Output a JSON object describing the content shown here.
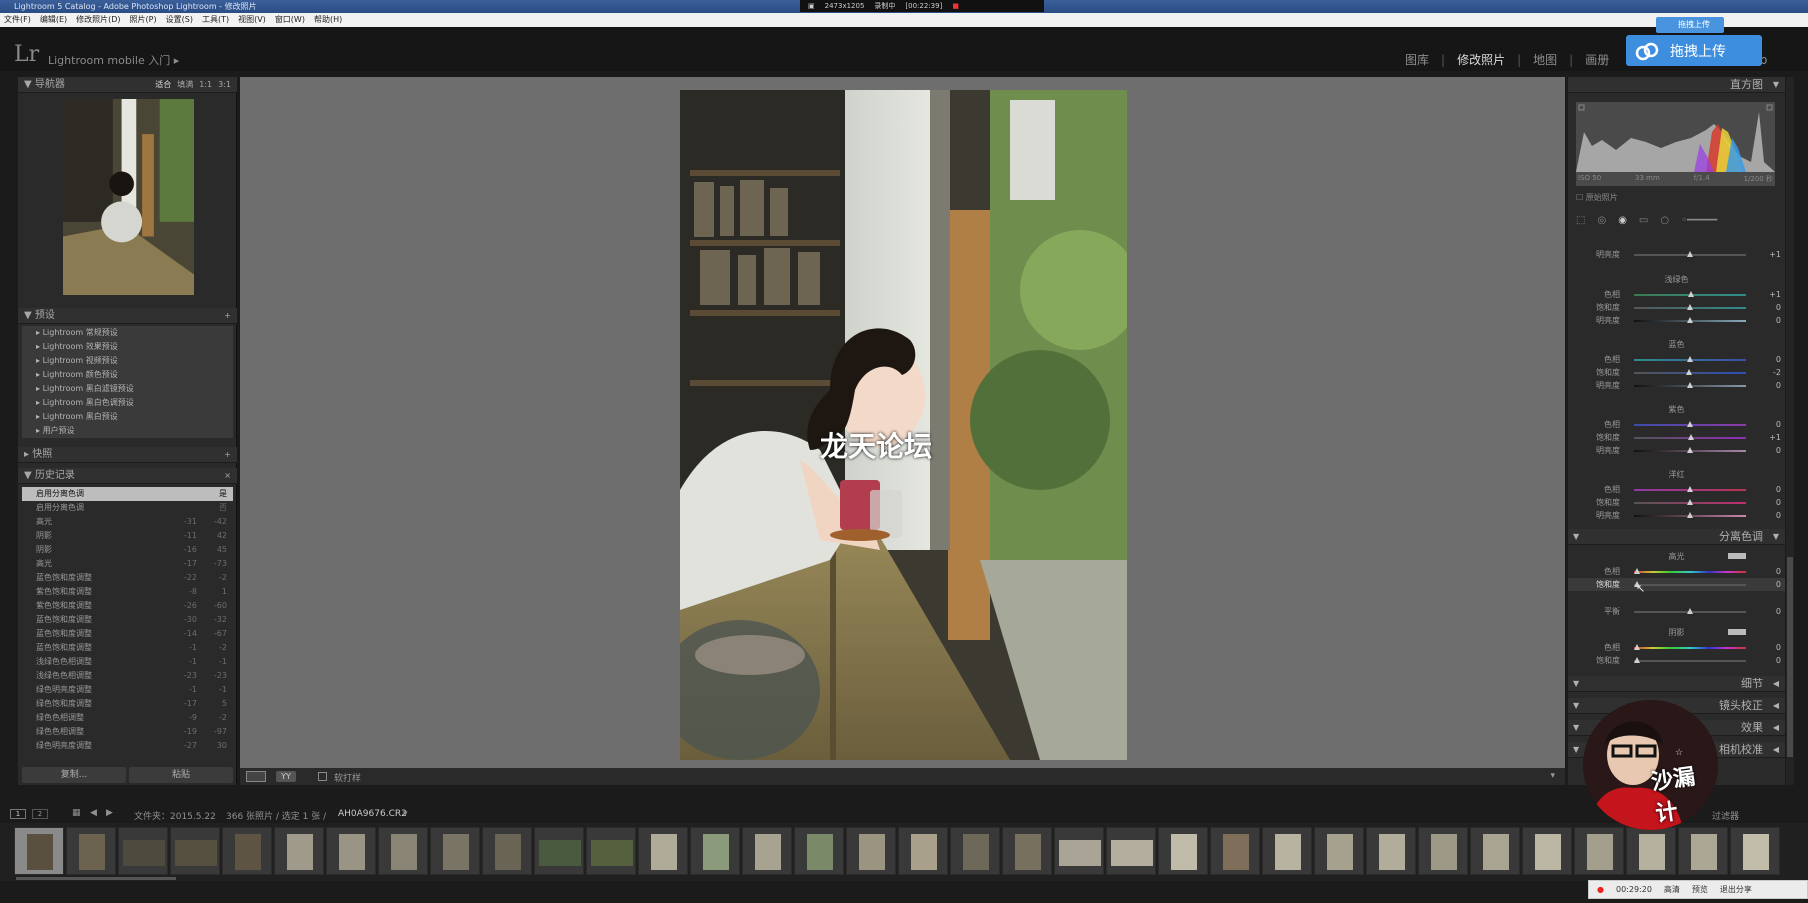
{
  "window": {
    "title": "Lightroom 5 Catalog - Adobe Photoshop Lightroom - 修改照片",
    "menu": [
      "文件(F)",
      "编辑(E)",
      "修改照片(D)",
      "照片(P)",
      "设置(S)",
      "工具(T)",
      "视图(V)",
      "窗口(W)",
      "帮助(H)"
    ]
  },
  "recorder": {
    "size": "2473x1205",
    "label": "录制中",
    "time": "[00:22:39]"
  },
  "app": {
    "logo": "Lr",
    "mobile": "Lightroom mobile 入门"
  },
  "modules": [
    {
      "label": "图库",
      "active": false
    },
    {
      "label": "修改照片",
      "active": true
    },
    {
      "label": "地图",
      "active": false
    },
    {
      "label": "画册",
      "active": false
    },
    {
      "label": "Web",
      "active": false
    }
  ],
  "upload": {
    "main": "拖拽上传",
    "small": "拖拽上传"
  },
  "left": {
    "navigator": {
      "title": "导航器",
      "zooms": [
        "适合",
        "填满",
        "1:1",
        "3:1"
      ]
    },
    "presets": {
      "title": "预设",
      "items": [
        "Lightroom 常规预设",
        "Lightroom 效果预设",
        "Lightroom 视频预设",
        "Lightroom 颜色预设",
        "Lightroom 黑白滤镜预设",
        "Lightroom 黑白色调预设",
        "Lightroom 黑白预设",
        "用户预设"
      ]
    },
    "snapshots": {
      "title": "快照"
    },
    "history": {
      "title": "历史记录",
      "items": [
        {
          "label": "启用分离色调",
          "v1": "",
          "v2": "是",
          "selected": true
        },
        {
          "label": "启用分离色调",
          "v1": "",
          "v2": "否"
        },
        {
          "label": "高光",
          "v1": "-31",
          "v2": "-42"
        },
        {
          "label": "阴影",
          "v1": "-11",
          "v2": "42"
        },
        {
          "label": "阴影",
          "v1": "-16",
          "v2": "45"
        },
        {
          "label": "高光",
          "v1": "-17",
          "v2": "-73"
        },
        {
          "label": "蓝色饱和度调整",
          "v1": "-22",
          "v2": "-2"
        },
        {
          "label": "紫色饱和度调整",
          "v1": "-8",
          "v2": "1"
        },
        {
          "label": "紫色饱和度调整",
          "v1": "-26",
          "v2": "-60"
        },
        {
          "label": "蓝色饱和度调整",
          "v1": "-30",
          "v2": "-32"
        },
        {
          "label": "蓝色饱和度调整",
          "v1": "-14",
          "v2": "-67"
        },
        {
          "label": "蓝色饱和度调整",
          "v1": "-1",
          "v2": "-2"
        },
        {
          "label": "浅绿色色相调整",
          "v1": "-1",
          "v2": "-1"
        },
        {
          "label": "浅绿色色相调整",
          "v1": "-23",
          "v2": "-23"
        },
        {
          "label": "绿色明亮度调整",
          "v1": "-1",
          "v2": "-1"
        },
        {
          "label": "绿色饱和度调整",
          "v1": "-17",
          "v2": "5"
        },
        {
          "label": "绿色色相调整",
          "v1": "-9",
          "v2": "-2"
        },
        {
          "label": "绿色色相调整",
          "v1": "-19",
          "v2": "-97"
        },
        {
          "label": "绿色明亮度调整",
          "v1": "-27",
          "v2": "30"
        }
      ]
    },
    "buttons": {
      "copy": "复制...",
      "paste": "粘贴"
    }
  },
  "watermark": "龙天论坛",
  "toolbar": {
    "softproof": "软打样"
  },
  "right": {
    "histogram": {
      "title": "直方图",
      "info": [
        "ISO 50",
        "33 mm",
        "f/1.4",
        "1/200 秒"
      ],
      "original": "原始照片"
    },
    "hsl": {
      "top_row": {
        "label": "明亮度",
        "val": "+1"
      },
      "groups": [
        {
          "name": "浅绿色",
          "rows": [
            {
              "label": "色相",
              "val": "+1"
            },
            {
              "label": "饱和度",
              "val": "0"
            },
            {
              "label": "明亮度",
              "val": "0"
            }
          ]
        },
        {
          "name": "蓝色",
          "rows": [
            {
              "label": "色相",
              "val": "0"
            },
            {
              "label": "饱和度",
              "val": "-2"
            },
            {
              "label": "明亮度",
              "val": "0"
            }
          ]
        },
        {
          "name": "紫色",
          "rows": [
            {
              "label": "色相",
              "val": "0"
            },
            {
              "label": "饱和度",
              "val": "+1"
            },
            {
              "label": "明亮度",
              "val": "0"
            }
          ]
        },
        {
          "name": "洋红",
          "rows": [
            {
              "label": "色相",
              "val": "0"
            },
            {
              "label": "饱和度",
              "val": "0"
            },
            {
              "label": "明亮度",
              "val": "0"
            }
          ]
        }
      ]
    },
    "split": {
      "title": "分离色调",
      "highlights": "高光",
      "hl_rows": [
        {
          "label": "色相",
          "val": "0"
        },
        {
          "label": "饱和度",
          "val": "0"
        }
      ],
      "balance": {
        "label": "平衡",
        "val": "0"
      },
      "shadows": "阴影",
      "sh_rows": [
        {
          "label": "色相",
          "val": "0"
        },
        {
          "label": "饱和度",
          "val": "0"
        }
      ]
    },
    "sections": [
      "细节",
      "镜头校正",
      "效果",
      "相机校准"
    ]
  },
  "filmbar": {
    "folder": "文件夹：2015.5.22",
    "count": "366 张照片 / 选定 1 张 /",
    "filename": "AH0A9676.CR2",
    "filter": "过滤器"
  },
  "overlay": {
    "singer_text": "沙漏计"
  },
  "status": {
    "time": "00:29:20",
    "buttons": [
      "高清",
      "预览",
      "退出分享"
    ]
  }
}
